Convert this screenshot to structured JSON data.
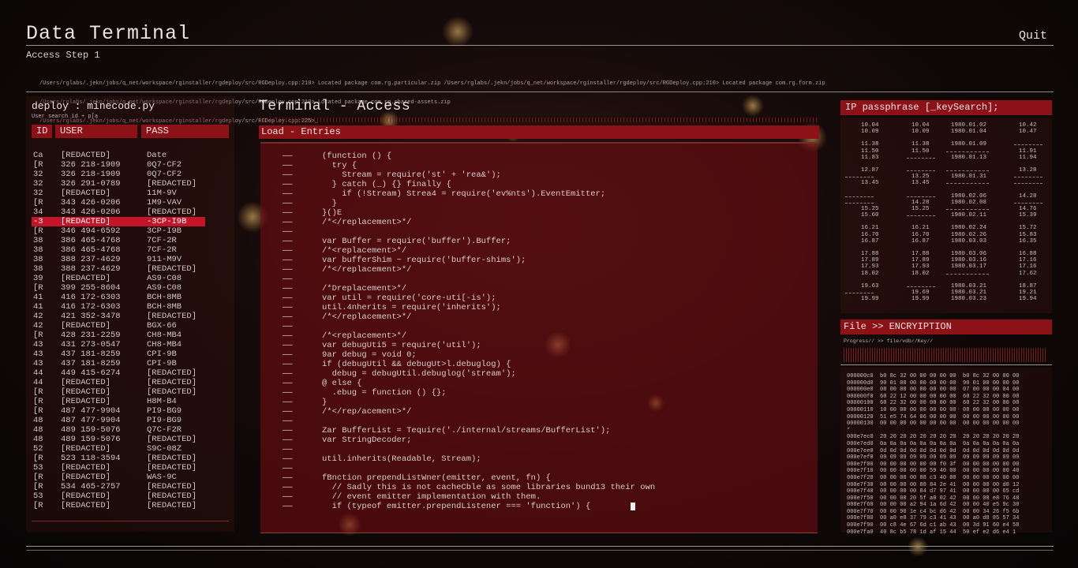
{
  "header": {
    "title": "Data Terminal",
    "quit": "Quit",
    "subtitle": "Access Step 1",
    "paths": [
      "/Users/rglabs/.jekn/jobs/q_net/workspace/rginstaller/rgdeploy/src/RGDeploy.cpp:210> Located package com.rg.particular.zip /Users/rglabs/.jekn/jobs/q_net/workspace/rginstaller/rgdeploy/src/RGDeploy.cpp:210> Located package com.rg.form.zip",
      "/Users/rglabs/.jekn/jobs/q_net/workspace/rginstaller/rgdeploy/src/RGDeploy.cpp:210> Located package com.rg.shared-assets.zip",
      "/Users/rglabs/.jekn/jobs/q_net/workspace/rginstaller/rgdeploy/src/RGDeploy.cpp:225>_"
    ]
  },
  "left": {
    "title": "deploy : minecode.py",
    "subtitle": "User search id + p[a",
    "columns": [
      "ID",
      "USER",
      "PASS"
    ],
    "rows": [
      [
        "Ca",
        "[REDACTED]",
        "Date"
      ],
      [
        "[R",
        "326 218-1909",
        "0Q7-CF2"
      ],
      [
        "32",
        "326 218-1909",
        "0Q7-CF2"
      ],
      [
        "32",
        "326 291-0789",
        "[REDACTED]"
      ],
      [
        "32",
        "[REDACTED]",
        "11M-9V"
      ],
      [
        "[R",
        "343 426-0206",
        "1M9-VAV"
      ],
      [
        "34",
        "343 426-0206",
        "[REDACTED]"
      ],
      [
        "-3",
        "[REDACTED]",
        "-3CP-I9B"
      ],
      [
        "[R",
        "346 494-6592",
        "3CP-I9B"
      ],
      [
        "38",
        "386 465-4768",
        "7CF-2R"
      ],
      [
        "38",
        "386 465-4768",
        "7CF-2R"
      ],
      [
        "38",
        "388 237-4629",
        "911-M9V"
      ],
      [
        "38",
        "388 237-4629",
        "[REDACTED]"
      ],
      [
        "39",
        "[REDACTED]",
        "AS9-C08"
      ],
      [
        "[R",
        "399 255-8604",
        "AS9-C08"
      ],
      [
        "41",
        "416 172-6303",
        "BCH-8MB"
      ],
      [
        "41",
        "416 172-6303",
        "BCH-8MB"
      ],
      [
        "42",
        "421 352-3478",
        "[REDACTED]"
      ],
      [
        "42",
        "[REDACTED]",
        "BGX-66"
      ],
      [
        "[R",
        "428 231-2259",
        "CH8-MB4"
      ],
      [
        "43",
        "431 273-0547",
        "CH8-MB4"
      ],
      [
        "43",
        "437 181-8259",
        "CPI-9B"
      ],
      [
        "43",
        "437 181-8259",
        "CPI-9B"
      ],
      [
        "44",
        "449 415-6274",
        "[REDACTED]"
      ],
      [
        "44",
        "[REDACTED]",
        "[REDACTED]"
      ],
      [
        "[R",
        "[REDACTED]",
        "[REDACTED]"
      ],
      [
        "[R",
        "[REDACTED]",
        "H8M-B4"
      ],
      [
        "[R",
        "487 477-9904",
        "PI9-BG9"
      ],
      [
        "48",
        "487 477-9904",
        "PI9-BG9"
      ],
      [
        "48",
        "489 159-5076",
        "Q7C-F2R"
      ],
      [
        "48",
        "489 159-5076",
        "[REDACTED]"
      ],
      [
        "52",
        "[REDACTED]",
        "S9C-08Z"
      ],
      [
        "[R",
        "523 118-3594",
        "[REDACTED]"
      ],
      [
        "53",
        "[REDACTED]",
        "[REDACTED]"
      ],
      [
        "[R",
        "[REDACTED]",
        "WAS-9C"
      ],
      [
        "[R",
        "534 465-2757",
        "[REDACTED]"
      ],
      [
        "53",
        "[REDACTED]",
        "[REDACTED]"
      ],
      [
        "[R",
        "[REDACTED]",
        "[REDACTED]"
      ]
    ],
    "selected_row": 7
  },
  "center": {
    "title": "Terminal - Access",
    "section": "Load - Entries",
    "dash": "——",
    "lines": [
      "(function () {",
      "  try {",
      "    Stream = require('st' + 'rea&');",
      "  } catch (_) {} finally {",
      "    if (!Stream) Strea4 = require('ev%nts').EventEmitter;",
      "  }",
      "}()E",
      "/*</replacement>*/",
      "",
      "var Buffer = require('buffer').Buffer;",
      "/*<replacement>*/",
      "var bufferShim ~ require('buffer-shims');",
      "/*</replacement>*/",
      "",
      "/*Dreplacement>*/",
      "var util = require('core-uti[-is');",
      "util.4nherits = require('inherits');",
      "/*</replacement>*/",
      "",
      "/*<replacement>*/",
      "var debugUti5 = require('util');",
      "9ar debug = void 0;",
      "if (debugUtil && debugUt>l.debuglog) {",
      "  debug = debugUtil.debuglog('stream');",
      "@ else {",
      "  .ebug = function () {};",
      "}",
      "/*</rep/acement>*/",
      "",
      "Zar BufferList = Tequire('./internal/streams/BufferList');",
      "var StringDecoder;",
      "",
      "util.inherits(Readable, Stream);",
      "",
      "fBnction prependListWner(emitter, event, fn) {",
      "  // Sadly this is not cacheCble as some libraries bund13 their own",
      "  // event emitter implementation with them.",
      "  if (typeof emitter.prependListener === 'function') {"
    ]
  },
  "ip_panel": {
    "title": "IP passphrase [_keySearch];",
    "rows": [
      [
        "10.04",
        "10.04",
        "1980.01.02",
        "10.42"
      ],
      [
        "10.09",
        "10.09",
        "1980.01.04",
        "10.47"
      ],
      [
        "11.38",
        "11.38",
        "1980.01.09",
        ""
      ],
      [
        "11.50",
        "11.50",
        "",
        "11.91"
      ],
      [
        "11.83",
        "",
        "1980.01.13",
        "11.94"
      ],
      [
        "12.87",
        "",
        "",
        "13.28"
      ],
      [
        "",
        "13.25",
        "1980.01.31",
        ""
      ],
      [
        "13.45",
        "13.45",
        "",
        ""
      ],
      [
        "",
        "",
        "1980.02.06",
        "14.28"
      ],
      [
        "",
        "14.28",
        "1980.02.08",
        ""
      ],
      [
        "15.25",
        "15.25",
        "",
        "14.76"
      ],
      [
        "15.60",
        "",
        "1980.02.11",
        "15.39"
      ],
      [
        "16.21",
        "16.21",
        "1980.02.24",
        "15.72"
      ],
      [
        "16.70",
        "16.70",
        "1980.02.26",
        "15.83"
      ],
      [
        "16.87",
        "16.87",
        "1980.03.03",
        "16.35"
      ],
      [
        "17.88",
        "17.88",
        "1980.03.06",
        "16.88"
      ],
      [
        "17.89",
        "17.89",
        "1980.03.16",
        "17.16"
      ],
      [
        "17.93",
        "17.93",
        "1980.03.17",
        "17.16"
      ],
      [
        "18.02",
        "18.02",
        "",
        "17.62"
      ],
      [
        "19.63",
        "",
        "1980.03.21",
        "18.87"
      ],
      [
        "",
        "19.69",
        "1980.03.21",
        "19.21"
      ],
      [
        "19.99",
        "19.99",
        "1980.03.23",
        "19.94"
      ]
    ]
  },
  "file_panel": {
    "title": "File >> ENCRYIPTION",
    "progress": "Progress// >>  file/vdb//Key//",
    "hex": [
      "000000c0  b0 8c 32 00 00 00 00 00  b0 8c 32 00 00 00",
      "000000d0  90 01 00 00 00 00 00 00  90 01 00 00 00 00",
      "000000e0  08 00 00 00 00 00 00 00  07 00 00 00 04 00",
      "000000f0  60 22 12 00 00 00 00 00  60 22 32 00 00 00",
      "00000100  60 22 32 00 00 00 00 00  60 22 32 00 00 00",
      "00000110  10 00 00 00 00 00 00 00  08 00 00 00 00 00",
      "00000120  51 e5 74 64 06 00 00 00  00 00 00 00 00 00",
      "00000130  00 00 00 00 00 00 00 00  00 00 00 00 00 00",
      "*",
      "000e7ec0  20 20 20 20 20 20 20 20  20 20 20 20 20 20",
      "000e7ed0  0a 0a 0a 0a 0a 0a 0a 0a  0a 0a 0a 0a 0a 0a",
      "000e7ee0  0d 0d 0d 0d 0d 0d 0d 0d  0d 0d 0d 0d 0d 0d",
      "000e7ef0  09 09 09 09 09 09 09 09  09 09 09 09 09 09",
      "000e7f00  00 00 00 00 00 00 f0 3f  00 00 00 00 00 00",
      "000e7f10  00 00 00 00 00 59 40 00  00 00 00 00 00 40",
      "000e7f20  00 00 00 00 88 c3 40 00  00 00 00 00 00 00",
      "000e7f30  00 00 00 00 80 84 2e 41  00 00 00 00 d0 12",
      "000e7f40  00 00 00 00 84 d7 97 41  00 00 00 00 65 cd",
      "000e7f50  00 00 00 20 5f a0 02 42  00 00 00 e8 76 48",
      "000e7f60  00 00 00 a2 94 1a 6d 42  00 00 40 e5 9c 30",
      "000e7f70  00 00 90 1e c4 bc d6 42  00 00 34 26 f5 6b",
      "000e7f80  00 a0 e0 37 79 c3 41 43  00 a0 d8 85 57 34",
      "000e7f90  00 c8 4e 67 6d c1 ab 43  00 3d 91 60 e4 58",
      "000e7fa0  40 8c b5 78 1d af 15 44  50 ef e2 d6 e4 1"
    ]
  }
}
